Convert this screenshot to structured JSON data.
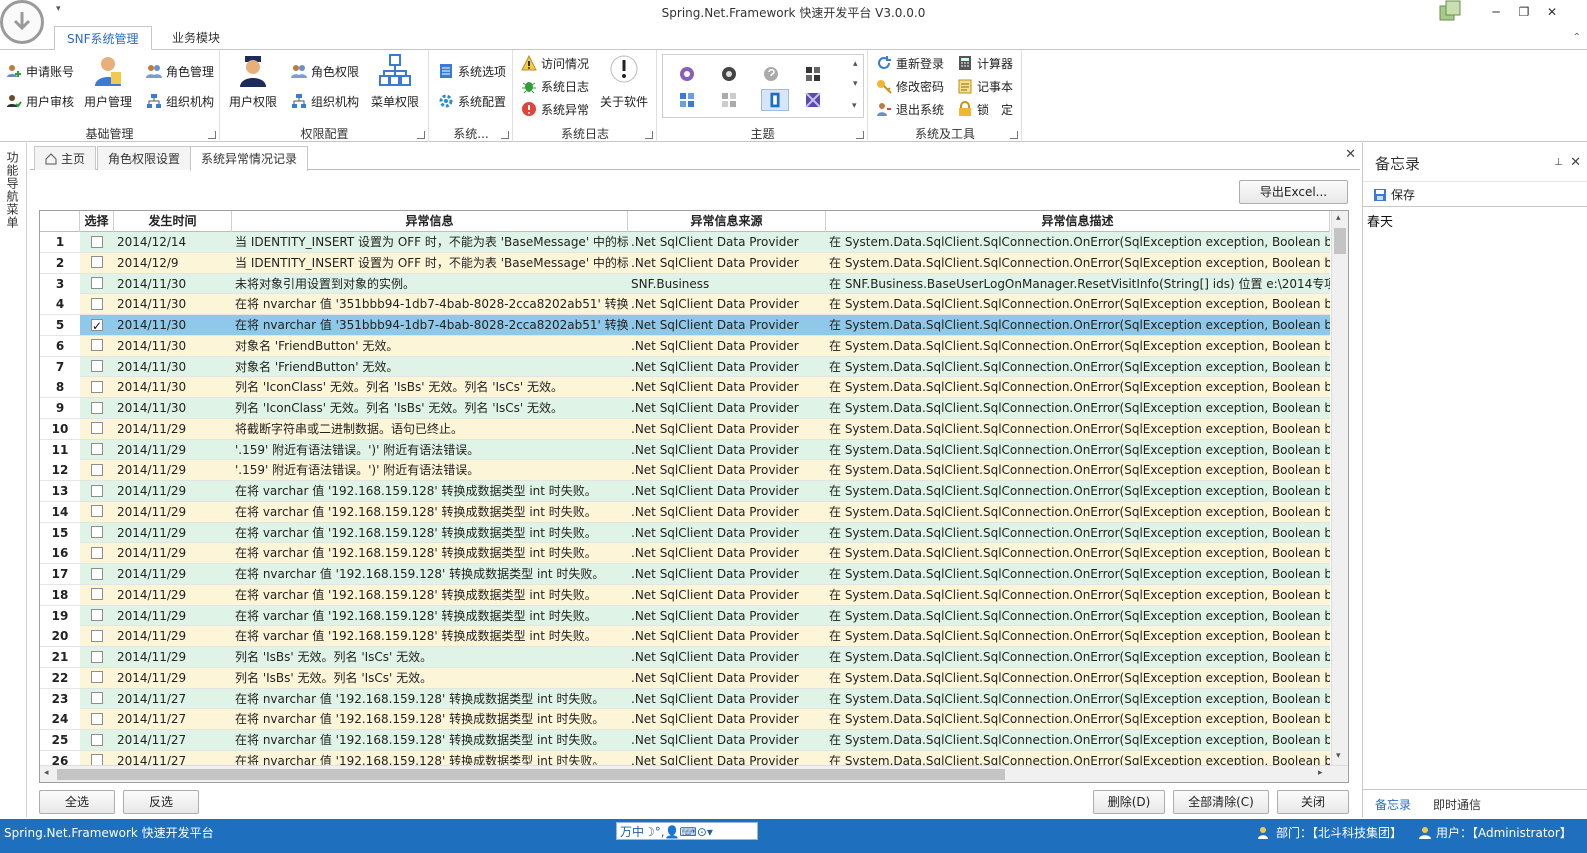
{
  "window": {
    "title": "Spring.Net.Framework 快速开发平台 V3.0.0.0",
    "controls": [
      "─",
      "❐",
      "✕"
    ]
  },
  "ribbon_tabs": [
    {
      "label": "SNF系统管理",
      "active": true
    },
    {
      "label": "业务模块",
      "active": false
    }
  ],
  "ribbon": {
    "groups": {
      "basic": {
        "label": "基础管理",
        "apply_account": "申请账号",
        "user_review": "用户审核",
        "user_manage": "用户管理",
        "role_manage": "角色管理",
        "org": "组织机构"
      },
      "permission": {
        "label": "权限配置",
        "user_permission": "用户权限",
        "role_permission": "角色权限",
        "org": "组织机构",
        "menu_permission": "菜单权限"
      },
      "system": {
        "label": "系统...",
        "options": "系统选项",
        "config": "系统配置"
      },
      "log": {
        "label": "系统日志",
        "visits": "访问情况",
        "syslog": "系统日志",
        "exceptions": "系统异常",
        "about": "关于软件"
      },
      "theme": {
        "label": "主题"
      },
      "tools": {
        "label": "系统及工具",
        "relogin": "重新登录",
        "change_password": "修改密码",
        "logout": "退出系统",
        "calculator": "计算器",
        "notepad": "记事本",
        "lock": "锁　定"
      }
    }
  },
  "left_nav": {
    "label": "功能导航菜单"
  },
  "doc_tabs": [
    {
      "label": "主页",
      "icon": "home-icon"
    },
    {
      "label": "角色权限设置"
    },
    {
      "label": "系统异常情况记录",
      "active": true
    }
  ],
  "export_button": "导出Excel...",
  "grid": {
    "columns": [
      "",
      "选择",
      "发生时间",
      "异常信息",
      "异常信息来源",
      "异常信息描述"
    ],
    "rows": [
      {
        "n": "1",
        "checked": false,
        "date": "2014/12/14",
        "msg": "当 IDENTITY_INSERT 设置为 OFF 时，不能为表 'BaseMessage' 中的标识列插入显式值。",
        "src": ".Net SqlClient Data Provider",
        "desc": "在 System.Data.SqlClient.SqlConnection.OnError(SqlException exception, Boolean breakCo"
      },
      {
        "n": "2",
        "checked": false,
        "date": "2014/12/9",
        "msg": "当 IDENTITY_INSERT 设置为 OFF 时，不能为表 'BaseMessage' 中的标识列插入显式值。",
        "src": ".Net SqlClient Data Provider",
        "desc": "在 System.Data.SqlClient.SqlConnection.OnError(SqlException exception, Boolean breakCo"
      },
      {
        "n": "3",
        "checked": false,
        "date": "2014/11/30",
        "msg": "未将对象引用设置到对象的实例。",
        "src": "SNF.Business",
        "desc": "在 SNF.Business.BaseUserLogOnManager.ResetVisitInfo(String[] ids) 位置 e:\\2014专项\\Spri"
      },
      {
        "n": "4",
        "checked": false,
        "date": "2014/11/30",
        "msg": "在将 nvarchar 值 '351bbb94-1db7-4bab-8028-2cca8202ab51' 转换成数据类型 int 时失败。",
        "src": ".Net SqlClient Data Provider",
        "desc": "在 System.Data.SqlClient.SqlConnection.OnError(SqlException exception, Boolean breakCo"
      },
      {
        "n": "5",
        "checked": true,
        "selected": true,
        "date": "2014/11/30",
        "msg": "在将 nvarchar 值 '351bbb94-1db7-4bab-8028-2cca8202ab51' 转换成数据类型 int 时失败。",
        "src": ".Net SqlClient Data Provider",
        "desc": "在 System.Data.SqlClient.SqlConnection.OnError(SqlException exception, Boolean breakCo"
      },
      {
        "n": "6",
        "checked": false,
        "date": "2014/11/30",
        "msg": "对象名 'FriendButton' 无效。",
        "src": ".Net SqlClient Data Provider",
        "desc": "在 System.Data.SqlClient.SqlConnection.OnError(SqlException exception, Boolean breakCo"
      },
      {
        "n": "7",
        "checked": false,
        "date": "2014/11/30",
        "msg": "对象名 'FriendButton' 无效。",
        "src": ".Net SqlClient Data Provider",
        "desc": "在 System.Data.SqlClient.SqlConnection.OnError(SqlException exception, Boolean breakCo"
      },
      {
        "n": "8",
        "checked": false,
        "date": "2014/11/30",
        "msg": "列名 'IconClass' 无效。列名 'IsBs' 无效。列名 'IsCs' 无效。",
        "src": ".Net SqlClient Data Provider",
        "desc": "在 System.Data.SqlClient.SqlConnection.OnError(SqlException exception, Boolean breakCo"
      },
      {
        "n": "9",
        "checked": false,
        "date": "2014/11/30",
        "msg": "列名 'IconClass' 无效。列名 'IsBs' 无效。列名 'IsCs' 无效。",
        "src": ".Net SqlClient Data Provider",
        "desc": "在 System.Data.SqlClient.SqlConnection.OnError(SqlException exception, Boolean breakCo"
      },
      {
        "n": "10",
        "checked": false,
        "date": "2014/11/29",
        "msg": "将截断字符串或二进制数据。语句已终止。",
        "src": ".Net SqlClient Data Provider",
        "desc": "在 System.Data.SqlClient.SqlConnection.OnError(SqlException exception, Boolean breakCo"
      },
      {
        "n": "11",
        "checked": false,
        "date": "2014/11/29",
        "msg": "'.159' 附近有语法错误。')' 附近有语法错误。",
        "src": ".Net SqlClient Data Provider",
        "desc": "在 System.Data.SqlClient.SqlConnection.OnError(SqlException exception, Boolean breakCo"
      },
      {
        "n": "12",
        "checked": false,
        "date": "2014/11/29",
        "msg": "'.159' 附近有语法错误。')' 附近有语法错误。",
        "src": ".Net SqlClient Data Provider",
        "desc": "在 System.Data.SqlClient.SqlConnection.OnError(SqlException exception, Boolean breakCo"
      },
      {
        "n": "13",
        "checked": false,
        "date": "2014/11/29",
        "msg": "在将 varchar 值 '192.168.159.128' 转换成数据类型 int 时失败。",
        "src": ".Net SqlClient Data Provider",
        "desc": "在 System.Data.SqlClient.SqlConnection.OnError(SqlException exception, Boolean breakCo"
      },
      {
        "n": "14",
        "checked": false,
        "date": "2014/11/29",
        "msg": "在将 varchar 值 '192.168.159.128' 转换成数据类型 int 时失败。",
        "src": ".Net SqlClient Data Provider",
        "desc": "在 System.Data.SqlClient.SqlConnection.OnError(SqlException exception, Boolean breakCo"
      },
      {
        "n": "15",
        "checked": false,
        "date": "2014/11/29",
        "msg": "在将 varchar 值 '192.168.159.128' 转换成数据类型 int 时失败。",
        "src": ".Net SqlClient Data Provider",
        "desc": "在 System.Data.SqlClient.SqlConnection.OnError(SqlException exception, Boolean breakCo"
      },
      {
        "n": "16",
        "checked": false,
        "date": "2014/11/29",
        "msg": "在将 varchar 值 '192.168.159.128' 转换成数据类型 int 时失败。",
        "src": ".Net SqlClient Data Provider",
        "desc": "在 System.Data.SqlClient.SqlConnection.OnError(SqlException exception, Boolean breakCo"
      },
      {
        "n": "17",
        "checked": false,
        "date": "2014/11/29",
        "msg": "在将 nvarchar 值 '192.168.159.128' 转换成数据类型 int 时失败。",
        "src": ".Net SqlClient Data Provider",
        "desc": "在 System.Data.SqlClient.SqlConnection.OnError(SqlException exception, Boolean breakCo"
      },
      {
        "n": "18",
        "checked": false,
        "date": "2014/11/29",
        "msg": "在将 varchar 值 '192.168.159.128' 转换成数据类型 int 时失败。",
        "src": ".Net SqlClient Data Provider",
        "desc": "在 System.Data.SqlClient.SqlConnection.OnError(SqlException exception, Boolean breakCo"
      },
      {
        "n": "19",
        "checked": false,
        "date": "2014/11/29",
        "msg": "在将 varchar 值 '192.168.159.128' 转换成数据类型 int 时失败。",
        "src": ".Net SqlClient Data Provider",
        "desc": "在 System.Data.SqlClient.SqlConnection.OnError(SqlException exception, Boolean breakCo"
      },
      {
        "n": "20",
        "checked": false,
        "date": "2014/11/29",
        "msg": "在将 varchar 值 '192.168.159.128' 转换成数据类型 int 时失败。",
        "src": ".Net SqlClient Data Provider",
        "desc": "在 System.Data.SqlClient.SqlConnection.OnError(SqlException exception, Boolean breakCo"
      },
      {
        "n": "21",
        "checked": false,
        "date": "2014/11/29",
        "msg": "列名 'IsBs' 无效。列名 'IsCs' 无效。",
        "src": ".Net SqlClient Data Provider",
        "desc": "在 System.Data.SqlClient.SqlConnection.OnError(SqlException exception, Boolean breakCo"
      },
      {
        "n": "22",
        "checked": false,
        "date": "2014/11/29",
        "msg": "列名 'IsBs' 无效。列名 'IsCs' 无效。",
        "src": ".Net SqlClient Data Provider",
        "desc": "在 System.Data.SqlClient.SqlConnection.OnError(SqlException exception, Boolean breakCo"
      },
      {
        "n": "23",
        "checked": false,
        "date": "2014/11/27",
        "msg": "在将 nvarchar 值 '192.168.159.128' 转换成数据类型 int 时失败。",
        "src": ".Net SqlClient Data Provider",
        "desc": "在 System.Data.SqlClient.SqlConnection.OnError(SqlException exception, Boolean breakCo"
      },
      {
        "n": "24",
        "checked": false,
        "date": "2014/11/27",
        "msg": "在将 nvarchar 值 '192.168.159.128' 转换成数据类型 int 时失败。",
        "src": ".Net SqlClient Data Provider",
        "desc": "在 System.Data.SqlClient.SqlConnection.OnError(SqlException exception, Boolean breakCo"
      },
      {
        "n": "25",
        "checked": false,
        "date": "2014/11/27",
        "msg": "在将 nvarchar 值 '192.168.159.128' 转换成数据类型 int 时失败。",
        "src": ".Net SqlClient Data Provider",
        "desc": "在 System.Data.SqlClient.SqlConnection.OnError(SqlException exception, Boolean breakCo"
      },
      {
        "n": "26",
        "checked": false,
        "date": "2014/11/27",
        "msg": "在将 nvarchar 值 '192.168.159.128' 转换成数据类型 int 时失败。",
        "src": ".Net SqlClient Data Provider",
        "desc": "在 System.Data.SqlClient.SqlConnection.OnError(SqlException exception, Boolean breakCo"
      }
    ]
  },
  "bottom_buttons": {
    "select_all": "全选",
    "invert": "反选",
    "delete": "删除(D)",
    "delete_all": "全部清除(C)",
    "close": "关闭"
  },
  "memo": {
    "title": "备忘录",
    "save": "保存",
    "content": "春天",
    "tabs": [
      "备忘录",
      "即时通信"
    ]
  },
  "statusbar": {
    "left": "Spring.Net.Framework 快速开发平台",
    "ime": "万中☽°,👤⌨⊙▾",
    "dept": "部门：【北斗科技集团】",
    "user": "用户：【Administrator】"
  },
  "colors": {
    "accent": "#2b6cc4",
    "statusbar": "#1f6fbf",
    "row_green": "#dff3e6",
    "row_yellow": "#fdf5d8",
    "row_selected": "#8fc9ea"
  }
}
